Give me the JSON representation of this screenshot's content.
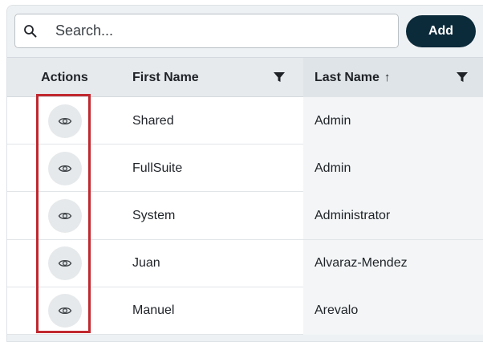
{
  "toolbar": {
    "search_placeholder": "Search...",
    "add_label": "Add"
  },
  "table": {
    "headers": {
      "actions": "Actions",
      "first_name": "First Name",
      "last_name": "Last Name",
      "last_name_sort": "↑"
    },
    "rows": [
      {
        "first_name": "Shared",
        "last_name": "Admin"
      },
      {
        "first_name": "FullSuite",
        "last_name": "Admin"
      },
      {
        "first_name": "System",
        "last_name": "Administrator"
      },
      {
        "first_name": "Juan",
        "last_name": "Alvaraz-Mendez"
      },
      {
        "first_name": "Manuel",
        "last_name": "Arevalo"
      }
    ]
  },
  "icons": {
    "search": "search-icon",
    "filter": "filter-icon",
    "view": "eye-icon"
  },
  "colors": {
    "primary_button": "#0b2a3a",
    "highlight": "#c0282f"
  }
}
